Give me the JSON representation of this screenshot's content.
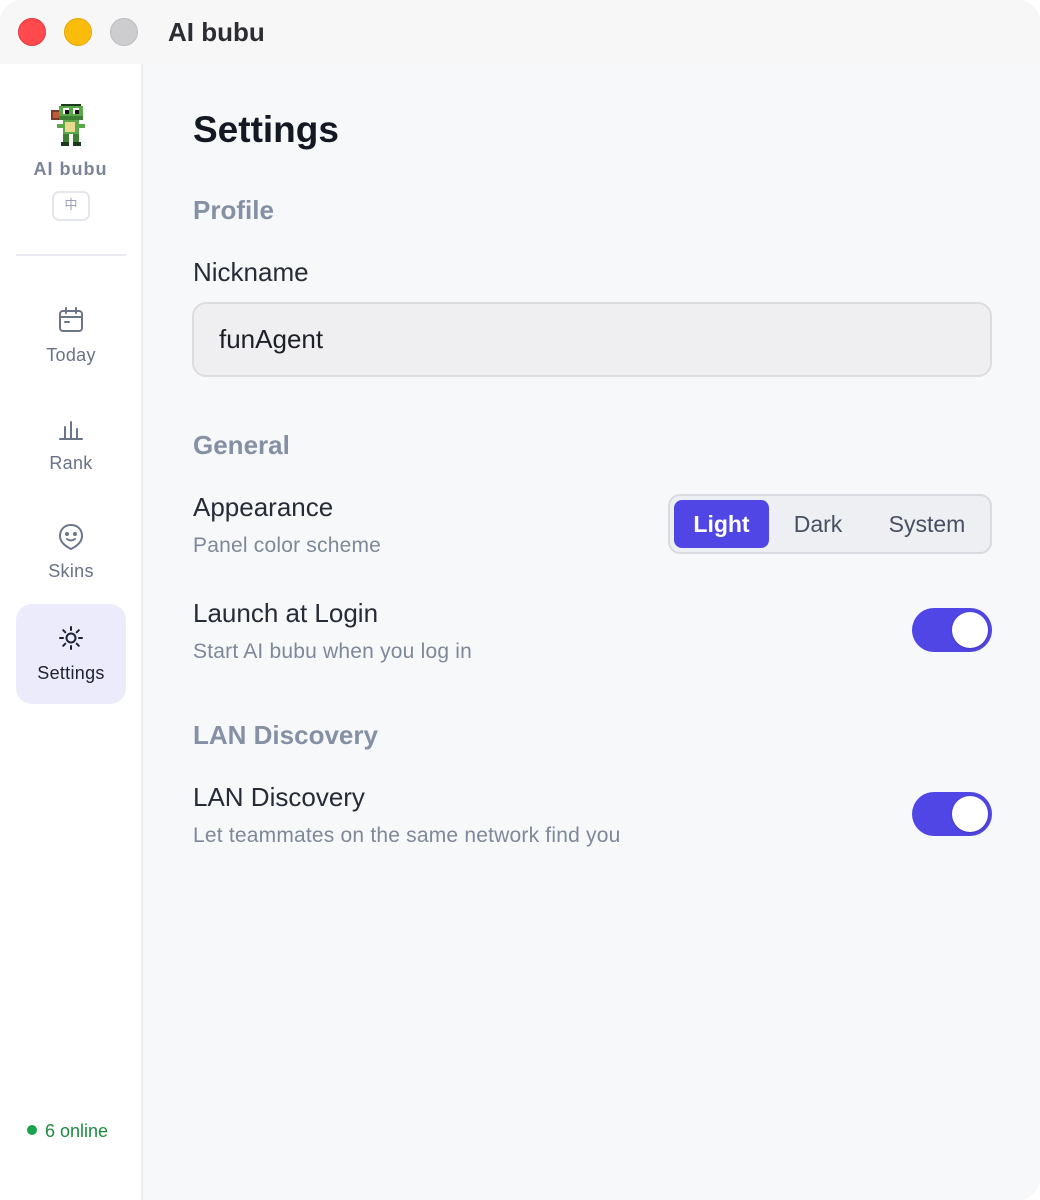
{
  "window": {
    "title": "AI bubu"
  },
  "sidebar": {
    "brand": "AI bubu",
    "language_button": "中",
    "items": [
      {
        "label": "Today",
        "icon": "calendar-icon"
      },
      {
        "label": "Rank",
        "icon": "bar-chart-icon"
      },
      {
        "label": "Skins",
        "icon": "face-icon"
      },
      {
        "label": "Settings",
        "icon": "sun-gear-icon",
        "active": true
      }
    ],
    "online_status": "6 online"
  },
  "settings": {
    "title": "Settings",
    "profile": {
      "section": "Profile",
      "nickname_label": "Nickname",
      "nickname_value": "funAgent"
    },
    "general": {
      "section": "General",
      "appearance_label": "Appearance",
      "appearance_desc": "Panel color scheme",
      "appearance_options": [
        "Light",
        "Dark",
        "System"
      ],
      "appearance_selected": "Light",
      "launch_label": "Launch at Login",
      "launch_desc": "Start AI bubu when you log in",
      "launch_on": true
    },
    "lan": {
      "section": "LAN Discovery",
      "lan_label": "LAN Discovery",
      "lan_desc": "Let teammates on the same network find you",
      "lan_on": true
    }
  },
  "colors": {
    "accent": "#4f46e5",
    "online": "#19a24a",
    "active_nav_bg": "#ecebfb"
  }
}
